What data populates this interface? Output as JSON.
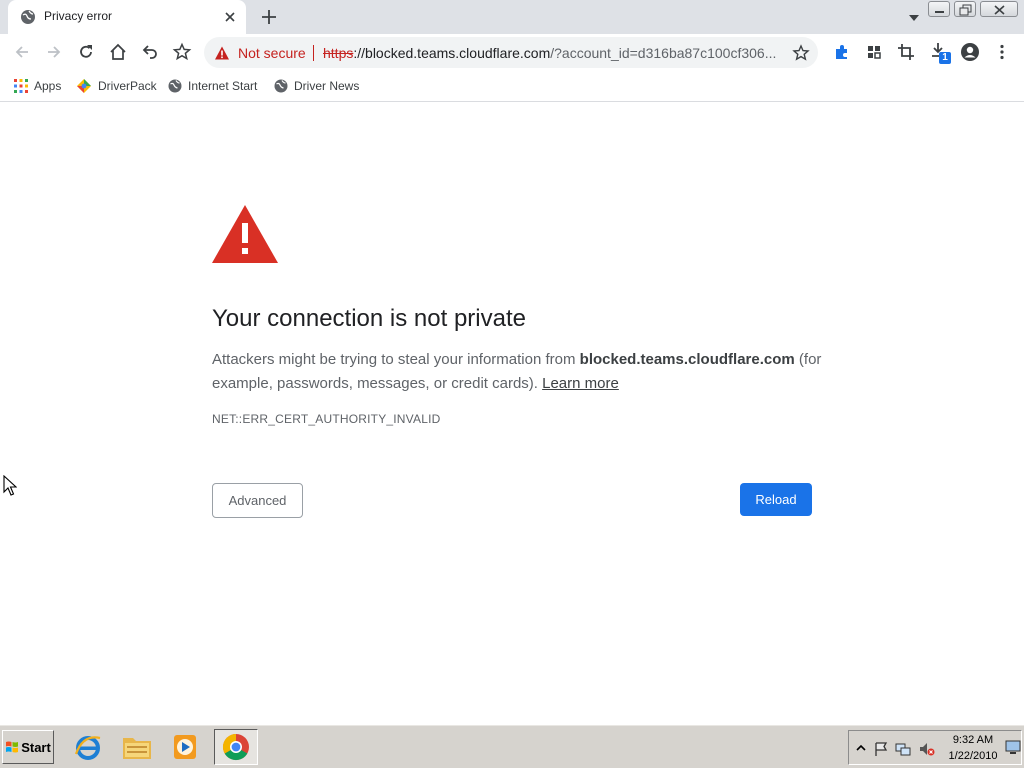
{
  "tab": {
    "title": "Privacy error"
  },
  "omnibox": {
    "security_label": "Not secure",
    "scheme": "https",
    "host": "://blocked.teams.cloudflare.com",
    "path": "/?account_id=d316ba87c100cf306..."
  },
  "download_badge": "1",
  "bookmarks": [
    {
      "label": "Apps",
      "icon": "apps-grid-icon"
    },
    {
      "label": "DriverPack",
      "icon": "driverpack-icon"
    },
    {
      "label": "Internet Start",
      "icon": "globe-icon"
    },
    {
      "label": "Driver News",
      "icon": "globe-icon"
    }
  ],
  "page": {
    "heading": "Your connection is not private",
    "desc_prefix": "Attackers might be trying to steal your information from ",
    "desc_host": "blocked.teams.cloudflare.com",
    "desc_suffix": " (for example, passwords, messages, or credit cards). ",
    "learn_more": "Learn more",
    "error_code": "NET::ERR_CERT_AUTHORITY_INVALID",
    "advanced_label": "Advanced",
    "reload_label": "Reload"
  },
  "taskbar": {
    "start_label": "Start",
    "clock_time": "9:32 AM",
    "clock_date": "1/22/2010"
  },
  "colors": {
    "tab_strip": "#dee1e6",
    "danger_red": "#d93025",
    "reload_blue": "#1a73e8",
    "extensions_blue": "#1a73e8",
    "taskbar_gray": "#d6d3ce"
  }
}
